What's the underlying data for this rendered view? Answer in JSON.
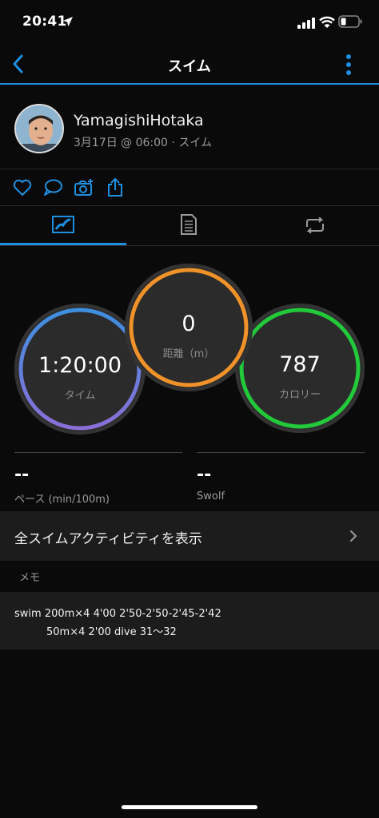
{
  "status": {
    "time": "20:41"
  },
  "nav": {
    "title": "スイム"
  },
  "profile": {
    "name": "YamagishiHotaka",
    "subtitle": "3月17日 @ 06:00 · スイム"
  },
  "gauges": {
    "time": {
      "value": "1:20:00",
      "label": "タイム",
      "color": "#3d8fe0"
    },
    "distance": {
      "value": "0",
      "label": "距離（m）",
      "color": "#f0922a"
    },
    "calories": {
      "value": "787",
      "label": "カロリー",
      "color": "#22c93a"
    }
  },
  "stats": {
    "pace": {
      "value": "--",
      "label": "ペース (min/100m)"
    },
    "swolf": {
      "value": "--",
      "label": "Swolf"
    }
  },
  "all_activities": {
    "label": "全スイムアクティビティを表示"
  },
  "memo": {
    "heading": "メモ",
    "line1": "swim 200m×4 4'00 2'50-2'50-2'45-2'42",
    "line2": "50m×4 2'00 dive 31〜32"
  },
  "colors": {
    "accent": "#1f8fe0",
    "background": "#0a0a0a",
    "panel": "#1c1c1c"
  }
}
